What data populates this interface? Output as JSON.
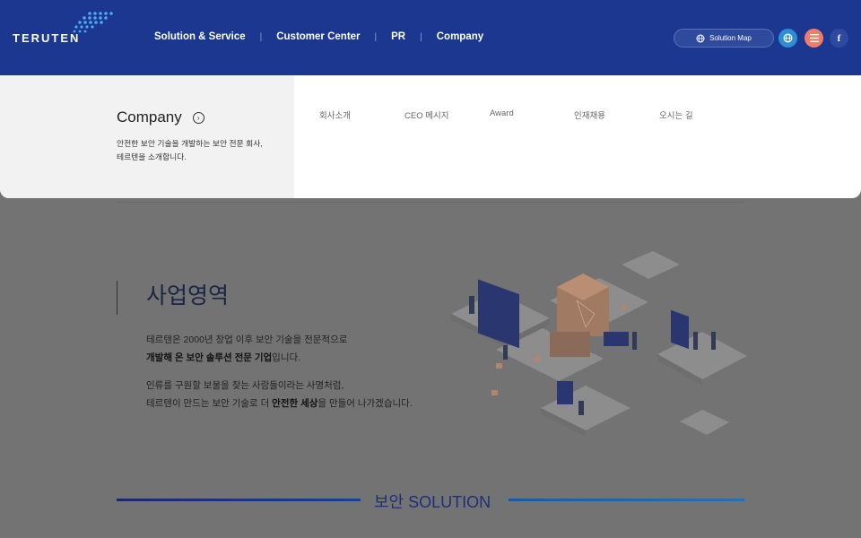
{
  "header": {
    "logo_text": "TERUTEN",
    "nav": [
      "Solution & Service",
      "Customer Center",
      "PR",
      "Company"
    ],
    "solution_map_label": "Solution Map",
    "facebook_label": "f",
    "colors": {
      "bg": "#1b3790",
      "globe": "#2e8cd9",
      "menu": "#f27c6c"
    }
  },
  "dropdown": {
    "title": "Company",
    "desc_line1": "안전한 보안 기술을 개발하는 보안 전문 회사,",
    "desc_line2": "테르텐을 소개합니다.",
    "links": [
      "회사소개",
      "CEO 메시지",
      "Award",
      "인재채용",
      "오시는 길"
    ]
  },
  "main": {
    "title": "사업영역",
    "para1_line1": "테르텐은 2000년 창업 이후 보안 기술을 전문적으로",
    "para1_line2_bold": "개발해 온 보안 솔루션 전문 기업",
    "para1_line2_rest": "입니다.",
    "para2_line1": "인류를 구원할 보물을 찾는 사람들이라는 사명처럼,",
    "para2_line2_a": "테르텐이 만드는 보안 기술로 더 ",
    "para2_line2_bold": "안전한 세상",
    "para2_line2_b": "을 만들어 나가겠습니다.",
    "solution_title": "보안 SOLUTION"
  }
}
